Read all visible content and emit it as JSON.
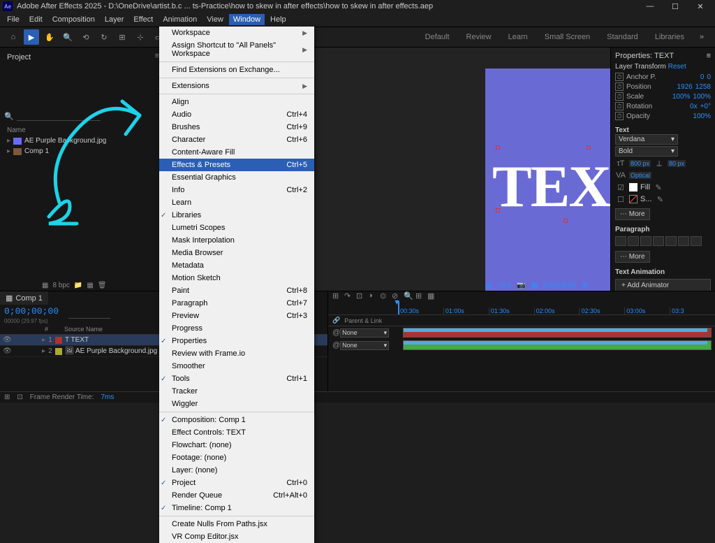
{
  "title": "Adobe After Effects 2025 - D:\\OneDrive\\artist.b.c ... ts-Practice\\how to skew in after effects\\how to skew in after effects.aep",
  "menus": [
    "File",
    "Edit",
    "Composition",
    "Layer",
    "Effect",
    "Animation",
    "View",
    "Window",
    "Help"
  ],
  "workspaces": [
    "Default",
    "Review",
    "Learn",
    "Small Screen",
    "Standard",
    "Libraries"
  ],
  "project": {
    "tab": "Project",
    "header": "Name",
    "items": [
      {
        "name": "AE Purple Background.jpg",
        "type": "img"
      },
      {
        "name": "Comp 1",
        "type": "comp"
      }
    ]
  },
  "bpc": "8 bpc",
  "props": {
    "title": "Properties: TEXT",
    "layer_transform": "Layer Transform",
    "reset": "Reset",
    "rows": [
      {
        "l": "Anchor P.",
        "v1": "0",
        "v2": "0"
      },
      {
        "l": "Position",
        "v1": "1926",
        "v2": "1258"
      },
      {
        "l": "Scale",
        "v1": "100%",
        "v2": "100%"
      },
      {
        "l": "Rotation",
        "v1": "0x",
        "v2": "+0°"
      },
      {
        "l": "Opacity",
        "v1": "100%",
        "v2": ""
      }
    ],
    "text_head": "Text",
    "font": "Verdana",
    "weight": "Bold",
    "size": "800 px",
    "leading": "80 px",
    "tracking": "Optical",
    "fill": "Fill",
    "stroke": "S...",
    "more": "More",
    "para": "Paragraph",
    "anim": "Text Animation",
    "add_anim": "Add Animator"
  },
  "viewer": {
    "pct": "+0.0",
    "time": "0;00;00;00"
  },
  "canvas_text": "TEXT",
  "timeline": {
    "comp": "Comp 1",
    "time": "0;00;00;00",
    "sub": "00000 (29.97 fps)",
    "cols": {
      "num": "#",
      "src": "Source Name",
      "parent": "Parent & Link"
    },
    "layers": [
      {
        "num": "1",
        "name": "TEXT",
        "col": "red",
        "parent": "None"
      },
      {
        "num": "2",
        "name": "AE Purple Background.jpg",
        "col": "yel",
        "parent": "None"
      }
    ],
    "ticks": [
      "00:30s",
      "01:00s",
      "01:30s",
      "02:00s",
      "02:30s",
      "03:00s",
      "03:3"
    ]
  },
  "footer": {
    "label": "Frame Render Time:",
    "ms": "7ms"
  },
  "dropdown": [
    {
      "t": "Workspace",
      "a": ">"
    },
    {
      "t": "Assign Shortcut to \"All Panels\" Workspace",
      "a": ">"
    },
    {
      "sep": 1
    },
    {
      "t": "Find Extensions on Exchange..."
    },
    {
      "sep": 1
    },
    {
      "t": "Extensions",
      "a": ">"
    },
    {
      "sep": 1
    },
    {
      "t": "Align"
    },
    {
      "t": "Audio",
      "s": "Ctrl+4"
    },
    {
      "t": "Brushes",
      "s": "Ctrl+9"
    },
    {
      "t": "Character",
      "s": "Ctrl+6"
    },
    {
      "t": "Content-Aware Fill"
    },
    {
      "t": "Effects & Presets",
      "s": "Ctrl+5",
      "hi": 1
    },
    {
      "t": "Essential Graphics"
    },
    {
      "t": "Info",
      "s": "Ctrl+2"
    },
    {
      "t": "Learn"
    },
    {
      "t": "Libraries",
      "c": 1
    },
    {
      "t": "Lumetri Scopes"
    },
    {
      "t": "Mask Interpolation"
    },
    {
      "t": "Media Browser"
    },
    {
      "t": "Metadata"
    },
    {
      "t": "Motion Sketch"
    },
    {
      "t": "Paint",
      "s": "Ctrl+8"
    },
    {
      "t": "Paragraph",
      "s": "Ctrl+7"
    },
    {
      "t": "Preview",
      "s": "Ctrl+3"
    },
    {
      "t": "Progress"
    },
    {
      "t": "Properties",
      "c": 1
    },
    {
      "t": "Review with Frame.io"
    },
    {
      "t": "Smoother"
    },
    {
      "t": "Tools",
      "s": "Ctrl+1",
      "c": 1
    },
    {
      "t": "Tracker"
    },
    {
      "t": "Wiggler"
    },
    {
      "sep": 1
    },
    {
      "t": "Composition: Comp 1",
      "c": 1
    },
    {
      "t": "Effect Controls: TEXT"
    },
    {
      "t": "Flowchart: (none)"
    },
    {
      "t": "Footage: (none)"
    },
    {
      "t": "Layer: (none)"
    },
    {
      "t": "Project",
      "s": "Ctrl+0",
      "c": 1
    },
    {
      "t": "Render Queue",
      "s": "Ctrl+Alt+0"
    },
    {
      "t": "Timeline: Comp 1",
      "c": 1
    },
    {
      "sep": 1
    },
    {
      "t": "Create Nulls From Paths.jsx"
    },
    {
      "t": "VR Comp Editor.jsx"
    }
  ]
}
